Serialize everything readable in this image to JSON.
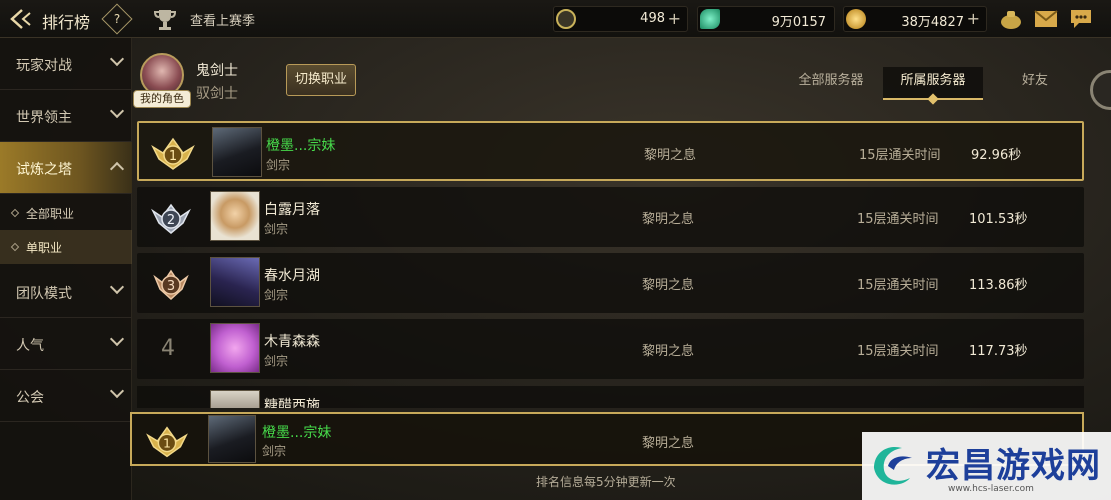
{
  "header": {
    "title": "排行榜",
    "help_label": "?",
    "last_season_label": "查看上赛季",
    "currencies": [
      {
        "icon": "season-coin-icon",
        "value": "498",
        "plus": "+",
        "color": "#c9b25a"
      },
      {
        "icon": "jade-gem-icon",
        "value": "9万0157",
        "plus": "+",
        "color": "#3fd0a0"
      },
      {
        "icon": "gold-coin-icon",
        "value": "38万4827",
        "plus": "+",
        "color": "#e2b23a"
      }
    ]
  },
  "sidebar": {
    "items": [
      {
        "label": "玩家对战",
        "expanded": false
      },
      {
        "label": "世界领主",
        "expanded": false
      },
      {
        "label": "试炼之塔",
        "expanded": true
      },
      {
        "label": "团队模式",
        "expanded": false
      },
      {
        "label": "人气",
        "expanded": false
      },
      {
        "label": "公会",
        "expanded": false
      }
    ],
    "sub_items": [
      {
        "label": "全部职业",
        "selected": false
      },
      {
        "label": "单职业",
        "selected": true
      }
    ]
  },
  "profile": {
    "name": "鬼剑士",
    "class": "驭剑士",
    "my_role_badge": "我的角色",
    "switch_button": "切换职业"
  },
  "tabs": [
    {
      "label": "全部服务器",
      "active": false
    },
    {
      "label": "所属服务器",
      "active": true
    },
    {
      "label": "好友",
      "active": false
    }
  ],
  "ranking": {
    "rows": [
      {
        "rank": "1",
        "name": "橙墨...宗妹",
        "class": "剑宗",
        "guild": "黎明之息",
        "floor": "15层通关时间",
        "time": "92.96秒",
        "highlight": true
      },
      {
        "rank": "2",
        "name": "白露月落",
        "class": "剑宗",
        "guild": "黎明之息",
        "floor": "15层通关时间",
        "time": "101.53秒",
        "highlight": false
      },
      {
        "rank": "3",
        "name": "春水月湖",
        "class": "剑宗",
        "guild": "黎明之息",
        "floor": "15层通关时间",
        "time": "113.86秒",
        "highlight": false
      },
      {
        "rank": "4",
        "name": "木青森森",
        "class": "剑宗",
        "guild": "黎明之息",
        "floor": "15层通关时间",
        "time": "117.73秒",
        "highlight": false
      }
    ],
    "partial_row": {
      "name": "糖醋西施"
    },
    "my_rank": {
      "rank": "1",
      "name": "橙墨...宗妹",
      "class": "剑宗",
      "guild": "黎明之息"
    }
  },
  "footer_note": "排名信息每5分钟更新一次",
  "watermark": {
    "title": "宏昌游戏网",
    "url": "www.hcs-laser.com"
  }
}
